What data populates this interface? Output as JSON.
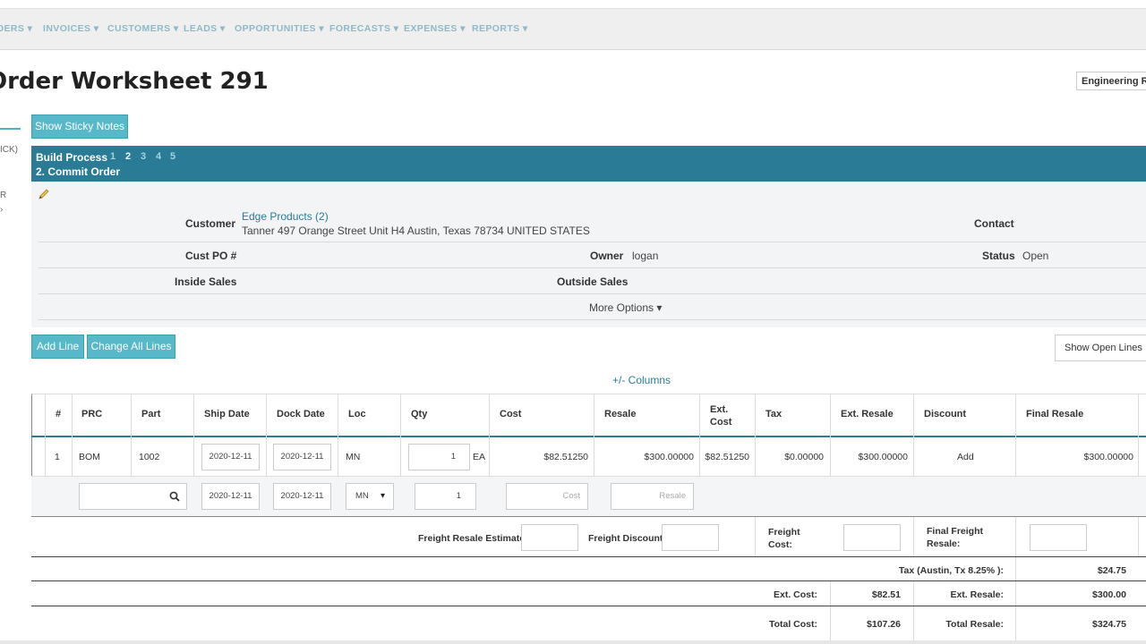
{
  "nav": {
    "items": [
      "ORDERS ▾",
      "INVOICES ▾",
      "CUSTOMERS ▾",
      "LEADS ▾",
      "OPPORTUNITIES ▾",
      "FORECASTS ▾",
      "EXPENSES ▾",
      "REPORTS ▾"
    ]
  },
  "page": {
    "title": "Order Worksheet 291",
    "engineering_button": "Engineering Re"
  },
  "sidebar": {
    "fragments": [
      "ICK)",
      "R",
      "›"
    ]
  },
  "sticky_button": "Show Sticky Notes",
  "build": {
    "label": "Build Process",
    "steps": [
      "1",
      "2",
      "3",
      "4",
      "5"
    ],
    "current": "2. Commit Order"
  },
  "order": {
    "customer_label": "Customer",
    "customer_name": "Edge Products (2)",
    "customer_address": "Tanner 497 Orange Street Unit H4 Austin, Texas 78734 UNITED STATES",
    "contact_label": "Contact",
    "cust_po_label": "Cust PO #",
    "owner_label": "Owner",
    "owner_value": "logan",
    "status_label": "Status",
    "status_value": "Open",
    "inside_sales_label": "Inside Sales",
    "outside_sales_label": "Outside Sales",
    "more_options": "More Options ▾"
  },
  "actions": {
    "add_line": "Add Line",
    "change_all": "Change All Lines",
    "show_open": "Show Open Lines",
    "columns_toggle": "+/- Columns"
  },
  "table": {
    "headers": [
      "#",
      "PRC",
      "Part",
      "Ship Date",
      "Dock Date",
      "Loc",
      "Qty",
      "Cost",
      "Resale",
      "Ext. Cost",
      "Tax",
      "Ext. Resale",
      "Discount",
      "Final Resale"
    ],
    "row": {
      "num": "1",
      "prc": "BOM",
      "part": "1002",
      "ship_date": "2020-12-11",
      "dock_date": "2020-12-11",
      "loc": "MN",
      "qty": "1",
      "unit": "EA",
      "cost": "$82.51250",
      "resale": "$300.00000",
      "ext_cost": "$82.51250",
      "tax": "$0.00000",
      "ext_resale": "$300.00000",
      "discount": "Add",
      "final_resale": "$300.00000"
    },
    "new_row": {
      "ship_date": "2020-12-11",
      "dock_date": "2020-12-11",
      "loc": "MN",
      "qty": "1",
      "cost_placeholder": "Cost",
      "resale_placeholder": "Resale"
    }
  },
  "freight": {
    "resale_estimate": "Freight Resale Estimate:",
    "discount": "Freight Discount:",
    "cost": "Freight Cost:",
    "final_resale": "Final Freight Resale:"
  },
  "totals": {
    "tax_label": "Tax (Austin, Tx 8.25% ):",
    "tax_value": "$24.75",
    "ext_cost_label": "Ext. Cost:",
    "ext_cost_value": "$82.51",
    "ext_resale_label": "Ext. Resale:",
    "ext_resale_value": "$300.00",
    "total_cost_label": "Total Cost:",
    "total_cost_value": "$107.26",
    "total_resale_label": "Total Resale:",
    "total_resale_value": "$324.75"
  },
  "colors": {
    "accent": "#2a7b96",
    "teal_button": "#56b8c8",
    "nav_text": "#8fb9c9"
  }
}
